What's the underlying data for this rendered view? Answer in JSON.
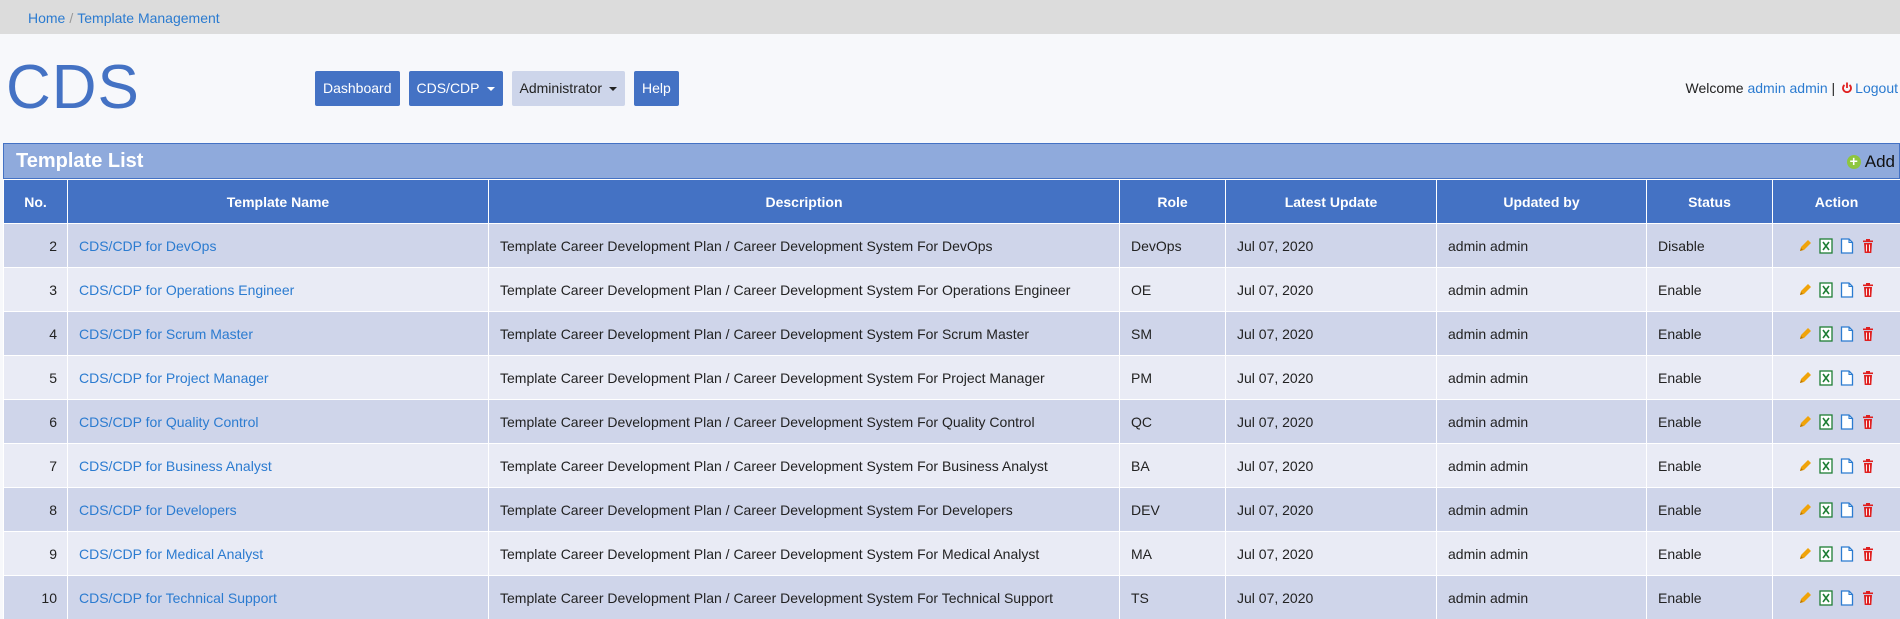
{
  "breadcrumb": {
    "home": "Home",
    "current": "Template Management"
  },
  "logo": "CDS",
  "nav": {
    "dashboard": "Dashboard",
    "cds_cdp": "CDS/CDP",
    "administrator": "Administrator",
    "help": "Help"
  },
  "user": {
    "welcome": "Welcome",
    "name": "admin admin",
    "separator": "|",
    "logout": "Logout"
  },
  "panel": {
    "title": "Template List",
    "add_label": "Add"
  },
  "table": {
    "headers": [
      "No.",
      "Template Name",
      "Description",
      "Role",
      "Latest Update",
      "Updated by",
      "Status",
      "Action"
    ],
    "rows": [
      {
        "no": "2",
        "name": "CDS/CDP for DevOps",
        "description": "Template Career Development Plan / Career Development System For DevOps",
        "role": "DevOps",
        "updated": "Jul 07, 2020",
        "by": "admin admin",
        "status": "Disable"
      },
      {
        "no": "3",
        "name": "CDS/CDP for Operations Engineer",
        "description": "Template Career Development Plan / Career Development System For Operations Engineer",
        "role": "OE",
        "updated": "Jul 07, 2020",
        "by": "admin admin",
        "status": "Enable"
      },
      {
        "no": "4",
        "name": "CDS/CDP for Scrum Master",
        "description": "Template Career Development Plan / Career Development System For Scrum Master",
        "role": "SM",
        "updated": "Jul 07, 2020",
        "by": "admin admin",
        "status": "Enable"
      },
      {
        "no": "5",
        "name": "CDS/CDP for Project Manager",
        "description": "Template Career Development Plan / Career Development System For Project Manager",
        "role": "PM",
        "updated": "Jul 07, 2020",
        "by": "admin admin",
        "status": "Enable"
      },
      {
        "no": "6",
        "name": "CDS/CDP for Quality Control",
        "description": "Template Career Development Plan / Career Development System For Quality Control",
        "role": "QC",
        "updated": "Jul 07, 2020",
        "by": "admin admin",
        "status": "Enable"
      },
      {
        "no": "7",
        "name": "CDS/CDP for Business Analyst",
        "description": "Template Career Development Plan / Career Development System For Business Analyst",
        "role": "BA",
        "updated": "Jul 07, 2020",
        "by": "admin admin",
        "status": "Enable"
      },
      {
        "no": "8",
        "name": "CDS/CDP for Developers",
        "description": "Template Career Development Plan / Career Development System For Developers",
        "role": "DEV",
        "updated": "Jul 07, 2020",
        "by": "admin admin",
        "status": "Enable"
      },
      {
        "no": "9",
        "name": "CDS/CDP for Medical Analyst",
        "description": "Template Career Development Plan / Career Development System For Medical Analyst",
        "role": "MA",
        "updated": "Jul 07, 2020",
        "by": "admin admin",
        "status": "Enable"
      },
      {
        "no": "10",
        "name": "CDS/CDP for Technical Support",
        "description": "Template Career Development Plan / Career Development System For Technical Support",
        "role": "TS",
        "updated": "Jul 07, 2020",
        "by": "admin admin",
        "status": "Enable"
      }
    ]
  },
  "colors": {
    "primary": "#4472c4",
    "panel": "#8faadc",
    "link": "#2b7bd0",
    "row_odd": "#cfd5ea",
    "row_even": "#e9ebf5",
    "edit": "#f0a30a",
    "excel": "#1e7e34",
    "doc": "#2b7bd0",
    "delete": "#e02020"
  },
  "action_icons": [
    "pencil-icon",
    "excel-icon",
    "document-icon",
    "trash-icon"
  ]
}
